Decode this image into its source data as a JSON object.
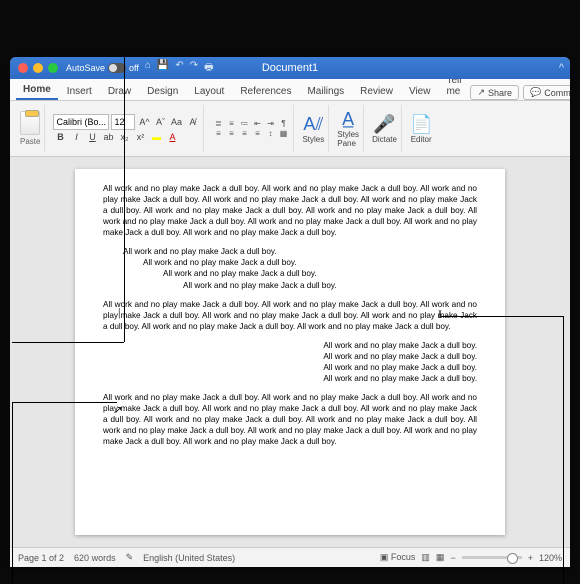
{
  "titlebar": {
    "autosave_label": "AutoSave",
    "autosave_state": "off",
    "doc_title": "Document1"
  },
  "tabs": {
    "items": [
      "Home",
      "Insert",
      "Draw",
      "Design",
      "Layout",
      "References",
      "Mailings",
      "Review",
      "View"
    ],
    "tellme": "Tell me",
    "share": "Share",
    "comments": "Comments",
    "active_index": 0
  },
  "ribbon": {
    "paste_label": "Paste",
    "font_name": "Calibri (Bo...",
    "font_size": "12",
    "styles_label": "Styles",
    "styles_pane_label": "Styles\nPane",
    "dictate_label": "Dictate",
    "editor_label": "Editor"
  },
  "document": {
    "sentence": "All work and no play make Jack a dull boy.",
    "para_long": "All work and no play make Jack a dull boy. All work and no play make Jack a dull boy. All work and no play make Jack a dull boy. All work and no play make Jack a dull boy. All work and no play make Jack a dull boy. All work and no play make Jack a dull boy. All work and no play make Jack a dull boy. All work and no play make Jack a dull boy. All work and no play make Jack a dull boy. All work and no play make Jack a dull boy. All work and no play make Jack a dull boy.",
    "para_med": "All work and no play make Jack a dull boy. All work and no play make Jack a dull boy. All work and no play make Jack a dull boy. All work and no play make Jack a dull boy. All work and no play make Jack a dull boy. All work and no play make Jack a dull boy. All work and no play make Jack a dull boy."
  },
  "statusbar": {
    "page": "Page 1 of 2",
    "words": "620 words",
    "language": "English (United States)",
    "focus": "Focus",
    "zoom": "120%"
  }
}
